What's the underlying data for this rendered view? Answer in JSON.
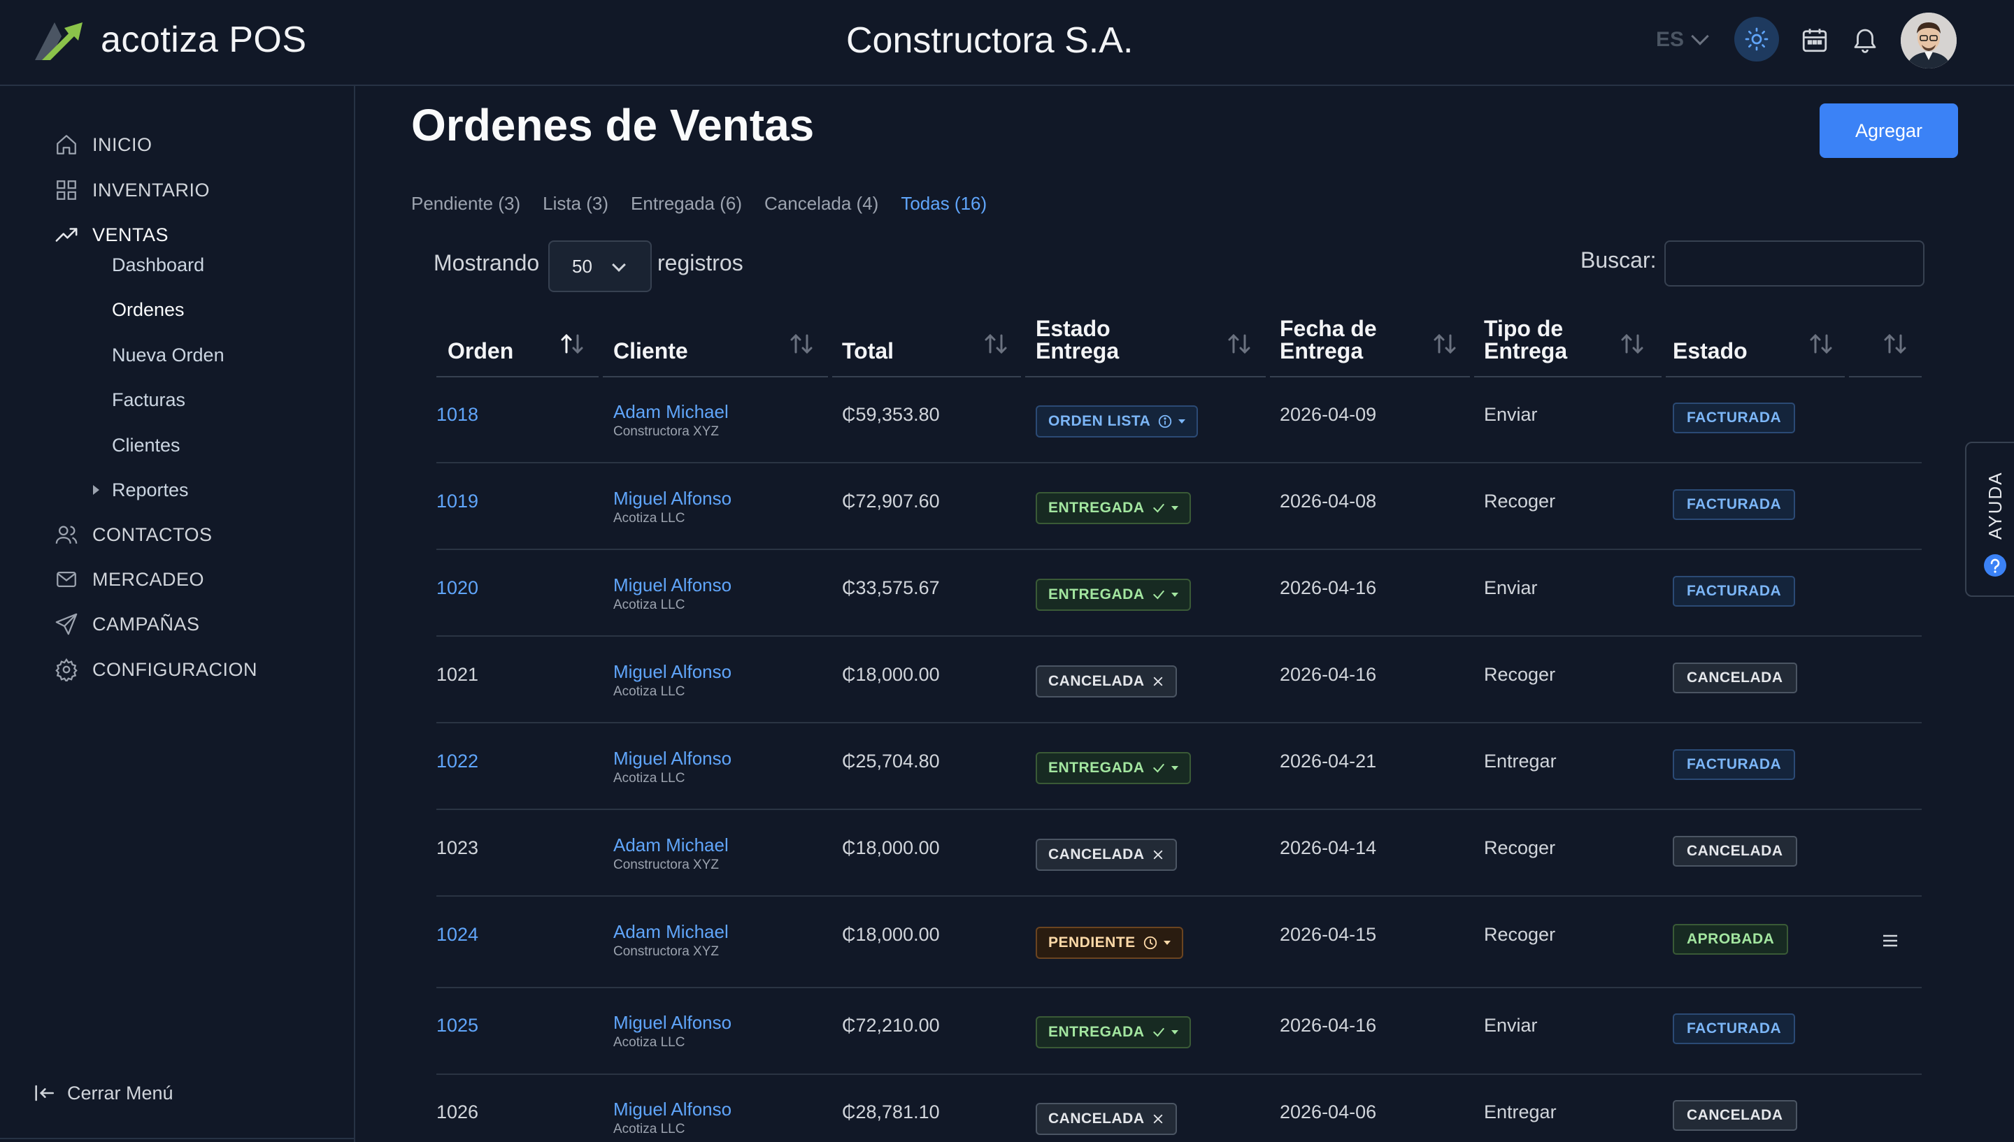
{
  "header": {
    "app_name": "acotiza POS",
    "company": "Constructora S.A.",
    "language": "ES"
  },
  "sidebar": {
    "items": [
      {
        "label": "INICIO",
        "icon": "home-icon"
      },
      {
        "label": "INVENTARIO",
        "icon": "grid-icon"
      },
      {
        "label": "VENTAS",
        "icon": "trending-up-icon"
      },
      {
        "label": "CONTACTOS",
        "icon": "users-icon"
      },
      {
        "label": "MERCADEO",
        "icon": "mail-icon"
      },
      {
        "label": "CAMPAÑAS",
        "icon": "send-icon"
      },
      {
        "label": "CONFIGURACION",
        "icon": "gear-icon"
      }
    ],
    "ventas_sub": [
      "Dashboard",
      "Ordenes",
      "Nueva Orden",
      "Facturas",
      "Clientes",
      "Reportes"
    ],
    "close_menu": "Cerrar Menú"
  },
  "main": {
    "title": "Ordenes de Ventas",
    "add_button": "Agregar",
    "tabs": [
      "Pendiente (3)",
      "Lista (3)",
      "Entregada (6)",
      "Cancelada (4)",
      "Todas (16)"
    ],
    "show_label": "Mostrando",
    "page_size": "50",
    "records_label": "registros",
    "search_label": "Buscar:"
  },
  "table": {
    "headers": {
      "orden": "Orden",
      "cliente": "Cliente",
      "total": "Total",
      "estado_entrega_1": "Estado",
      "estado_entrega_2": "Entrega",
      "fecha_1": "Fecha de",
      "fecha_2": "Entrega",
      "tipo_1": "Tipo de",
      "tipo_2": "Entrega",
      "estado": "Estado"
    },
    "rows": [
      {
        "orden": "1018",
        "cliente": "Adam Michael",
        "empresa": "Constructora XYZ",
        "total": "₵59,353.80",
        "entrega": "ORDEN LISTA",
        "fecha": "2026-04-09",
        "tipo": "Enviar",
        "estado": "FACTURADA"
      },
      {
        "orden": "1019",
        "cliente": "Miguel Alfonso",
        "empresa": "Acotiza LLC",
        "total": "₵72,907.60",
        "entrega": "ENTREGADA",
        "fecha": "2026-04-08",
        "tipo": "Recoger",
        "estado": "FACTURADA"
      },
      {
        "orden": "1020",
        "cliente": "Miguel Alfonso",
        "empresa": "Acotiza LLC",
        "total": "₵33,575.67",
        "entrega": "ENTREGADA",
        "fecha": "2026-04-16",
        "tipo": "Enviar",
        "estado": "FACTURADA"
      },
      {
        "orden": "1021",
        "cliente": "Miguel Alfonso",
        "empresa": "Acotiza LLC",
        "total": "₵18,000.00",
        "entrega": "CANCELADA",
        "fecha": "2026-04-16",
        "tipo": "Recoger",
        "estado": "CANCELADA"
      },
      {
        "orden": "1022",
        "cliente": "Miguel Alfonso",
        "empresa": "Acotiza LLC",
        "total": "₵25,704.80",
        "entrega": "ENTREGADA",
        "fecha": "2026-04-21",
        "tipo": "Entregar",
        "estado": "FACTURADA"
      },
      {
        "orden": "1023",
        "cliente": "Adam Michael",
        "empresa": "Constructora XYZ",
        "total": "₵18,000.00",
        "entrega": "CANCELADA",
        "fecha": "2026-04-14",
        "tipo": "Recoger",
        "estado": "CANCELADA"
      },
      {
        "orden": "1024",
        "cliente": "Adam Michael",
        "empresa": "Constructora XYZ",
        "total": "₵18,000.00",
        "entrega": "PENDIENTE",
        "fecha": "2026-04-15",
        "tipo": "Recoger",
        "estado": "APROBADA"
      },
      {
        "orden": "1025",
        "cliente": "Miguel Alfonso",
        "empresa": "Acotiza LLC",
        "total": "₵72,210.00",
        "entrega": "ENTREGADA",
        "fecha": "2026-04-16",
        "tipo": "Enviar",
        "estado": "FACTURADA"
      },
      {
        "orden": "1026",
        "cliente": "Miguel Alfonso",
        "empresa": "Acotiza LLC",
        "total": "₵28,781.10",
        "entrega": "CANCELADA",
        "fecha": "2026-04-06",
        "tipo": "Entregar",
        "estado": "CANCELADA"
      }
    ]
  },
  "help": {
    "label": "AYUDA"
  },
  "colors": {
    "accent": "#3b82f6",
    "link": "#60a5fa",
    "background": "#111827"
  }
}
